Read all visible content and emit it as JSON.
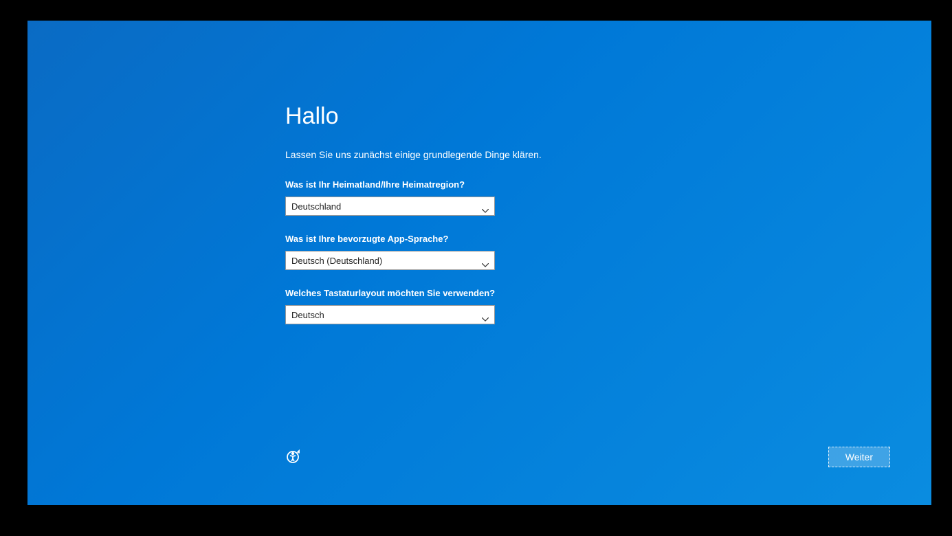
{
  "title": "Hallo",
  "subtitle": "Lassen Sie uns zunächst einige grundlegende Dinge klären.",
  "fields": {
    "country": {
      "label": "Was ist Ihr Heimatland/Ihre Heimatregion?",
      "value": "Deutschland"
    },
    "language": {
      "label": "Was ist Ihre bevorzugte App-Sprache?",
      "value": "Deutsch (Deutschland)"
    },
    "keyboard": {
      "label": "Welches Tastaturlayout möchten Sie verwenden?",
      "value": "Deutsch"
    }
  },
  "buttons": {
    "next": "Weiter"
  }
}
